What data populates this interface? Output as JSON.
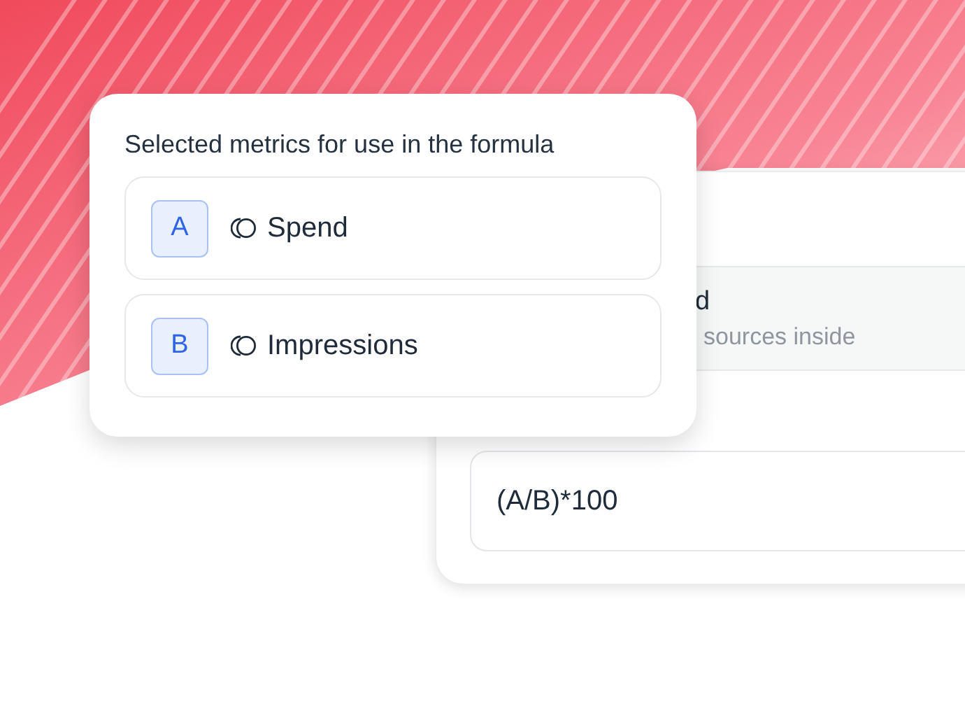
{
  "metrics_popup": {
    "title": "Selected metrics for use in the formula",
    "metrics": [
      {
        "letter": "A",
        "name": "Spend"
      },
      {
        "letter": "B",
        "name": "Impressions"
      }
    ]
  },
  "formula_card": {
    "source_row": {
      "title": "d",
      "subtitle": "sources inside"
    },
    "formula": {
      "value": "(A/B)*100"
    }
  }
}
